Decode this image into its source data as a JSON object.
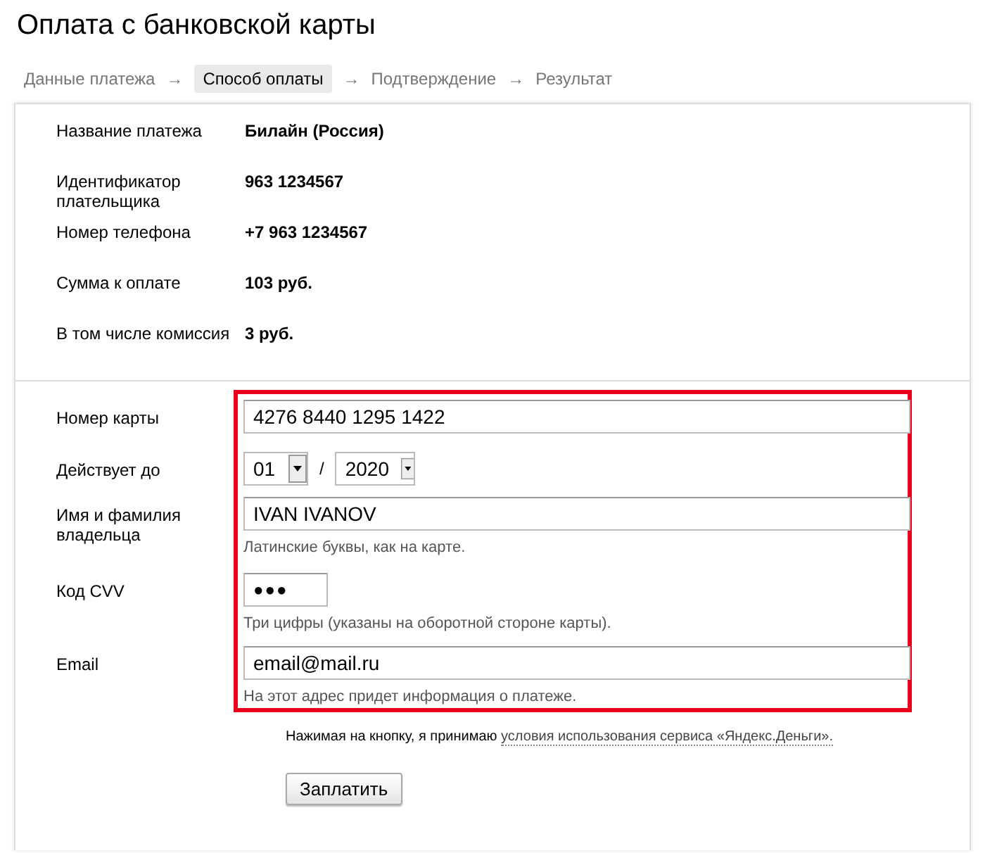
{
  "page": {
    "title": "Оплата с банковской карты"
  },
  "steps": [
    {
      "kind": "step",
      "label": "Данные платежа",
      "selected": false
    },
    {
      "kind": "arrow",
      "label": "→"
    },
    {
      "kind": "step",
      "label": "Способ оплаты",
      "selected": true
    },
    {
      "kind": "arrow",
      "label": "→"
    },
    {
      "kind": "step",
      "label": "Подтверждение",
      "selected": false
    },
    {
      "kind": "arrow",
      "label": "→"
    },
    {
      "kind": "step",
      "label": "Результат",
      "selected": false
    }
  ],
  "payment_details": [
    {
      "label": "Название платежа",
      "value": "Билайн (Россия)"
    },
    {
      "label": "Идентификатор плательщика",
      "value": "963 1234567"
    },
    {
      "label": "Номер телефона",
      "value": "+7 963 1234567"
    },
    {
      "label": "Сумма к оплате",
      "value": "103 руб."
    },
    {
      "label": "В том числе комиссия",
      "value": "3 руб."
    }
  ],
  "card_form": {
    "highlighted": true,
    "fields": [
      {
        "kind": "text",
        "label": "Номер карты",
        "value": "4276 8440 1295 1422"
      },
      {
        "kind": "expiry",
        "label": "Действует до",
        "month": "01",
        "separator": "/",
        "year": "2020"
      },
      {
        "kind": "text",
        "label": "Имя и фамилия владельца",
        "value": "IVAN IVANOV",
        "hint": "Латинские буквы, как на карте."
      },
      {
        "kind": "secret",
        "label": "Код CVV",
        "value": "●●●",
        "hint": "Три цифры (указаны на оборотной стороне карты)."
      },
      {
        "kind": "text",
        "label": "Email",
        "value": "email@mail.ru",
        "hint": "На этот адрес придет информация о платеже."
      }
    ]
  },
  "consent": {
    "text": "Нажимая на кнопку, я принимаю",
    "link": "условия использования сервиса «Яндекс.Деньги»."
  },
  "submit_button": "Заплатить"
}
